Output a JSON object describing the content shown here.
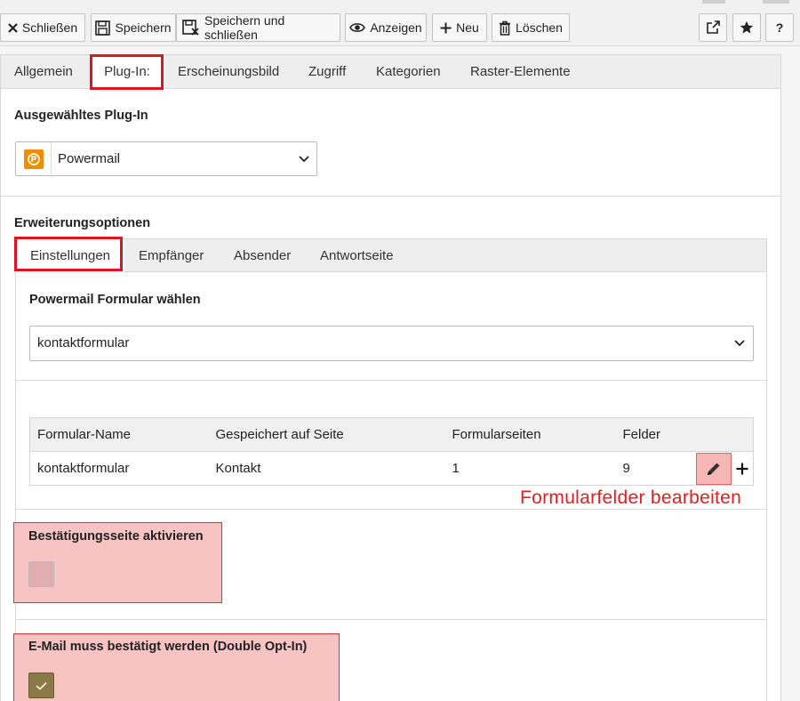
{
  "toolbar": {
    "close_label": "Schließen",
    "save_label": "Speichern",
    "save_close_label": "Speichern und schließen",
    "view_label": "Anzeigen",
    "new_label": "Neu",
    "delete_label": "Löschen",
    "open_new_window_icon": "external-link-icon",
    "bookmark_icon": "star-icon",
    "help_label": "?"
  },
  "tabs": [
    "Allgemein",
    "Plug-In:",
    "Erscheinungsbild",
    "Zugriff",
    "Kategorien",
    "Raster-Elemente"
  ],
  "active_tab": "Plug-In:",
  "plugin": {
    "section_title": "Ausgewähltes Plug-In",
    "selected": "Powermail",
    "icon": "powermail-icon"
  },
  "extension": {
    "section_title": "Erweiterungsoptionen",
    "tabs": [
      "Einstellungen",
      "Empfänger",
      "Absender",
      "Antwortseite"
    ],
    "active_tab": "Einstellungen",
    "form_select_title": "Powermail Formular wählen",
    "form_selected": "kontaktformular",
    "table": {
      "headers": [
        "Formular-Name",
        "Gespeichert auf Seite",
        "Formularseiten",
        "Felder"
      ],
      "rows": [
        [
          "kontaktformular",
          "Kontakt",
          "1",
          "9"
        ]
      ]
    },
    "annotation": "Formularfelder bearbeiten",
    "confirmation_page_label": "Bestätigungsseite aktivieren",
    "confirmation_page_checked": false,
    "double_optin_label": "E-Mail muss bestätigt werden (Double Opt-In)",
    "double_optin_checked": true
  },
  "colors": {
    "highlight_fill": "#f7c3c3",
    "highlight_border": "#e03030",
    "annotation_text": "#e02020",
    "powermail_orange": "#f28c00"
  }
}
